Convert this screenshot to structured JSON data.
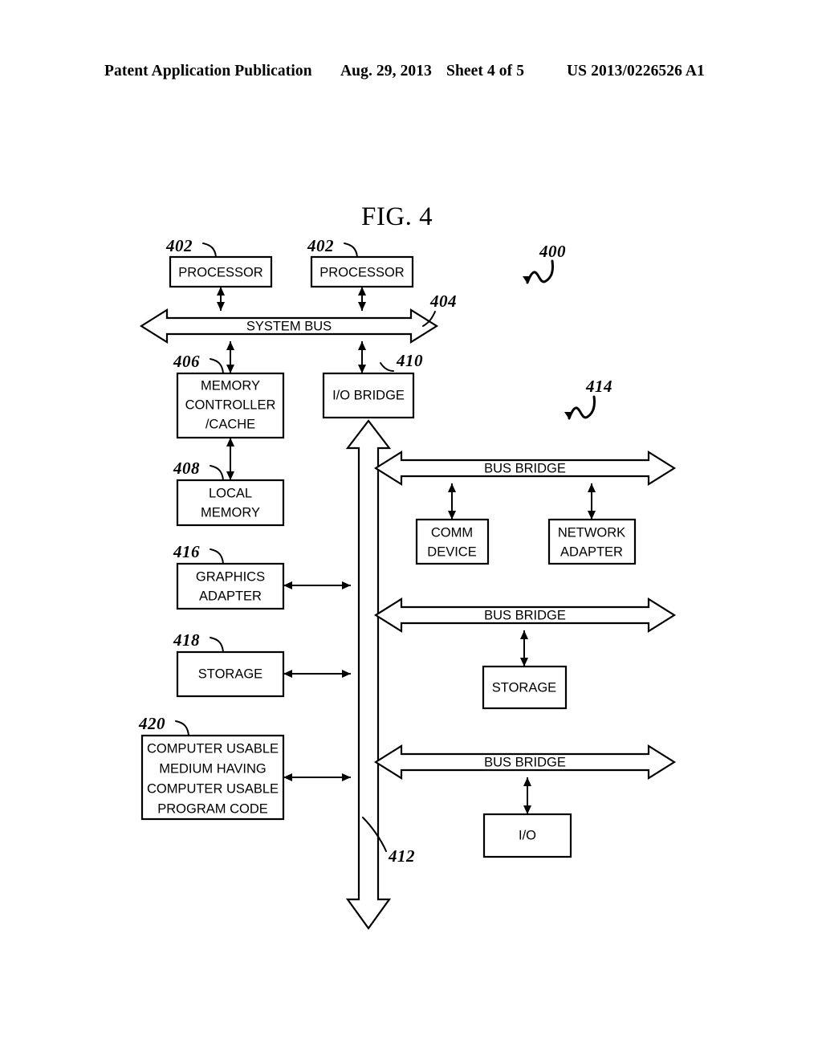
{
  "header": {
    "publication": "Patent Application Publication",
    "date": "Aug. 29, 2013",
    "sheet": "Sheet 4 of 5",
    "pub_number": "US 2013/0226526 A1"
  },
  "figure": {
    "title": "FIG. 4",
    "system_ref": "400",
    "blocks": {
      "processor_1": "PROCESSOR",
      "processor_2": "PROCESSOR",
      "system_bus": "SYSTEM BUS",
      "memory_controller_line1": "MEMORY",
      "memory_controller_line2": "CONTROLLER",
      "memory_controller_line3": "/CACHE",
      "io_bridge": "I/O BRIDGE",
      "local_memory_line1": "LOCAL",
      "local_memory_line2": "MEMORY",
      "graphics_adapter_line1": "GRAPHICS",
      "graphics_adapter_line2": "ADAPTER",
      "storage_left": "STORAGE",
      "cum_line1": "COMPUTER USABLE",
      "cum_line2": "MEDIUM HAVING",
      "cum_line3": "COMPUTER USABLE",
      "cum_line4": "PROGRAM CODE",
      "bus_bridge_1": "BUS BRIDGE",
      "bus_bridge_2": "BUS BRIDGE",
      "bus_bridge_3": "BUS BRIDGE",
      "comm_device_line1": "COMM",
      "comm_device_line2": "DEVICE",
      "network_adapter_line1": "NETWORK",
      "network_adapter_line2": "ADAPTER",
      "storage_right": "STORAGE",
      "io_right": "I/O"
    },
    "reference_numerals": {
      "processor_1": "402",
      "processor_2": "402",
      "system_bus": "404",
      "memory_controller": "406",
      "local_memory": "408",
      "io_bridge": "410",
      "io_bus": "412",
      "peripheral_bus": "414",
      "graphics_adapter": "416",
      "storage_left": "418",
      "computer_usable_medium": "420"
    },
    "colors": {
      "ink": "#000000",
      "paper": "#ffffff"
    }
  }
}
